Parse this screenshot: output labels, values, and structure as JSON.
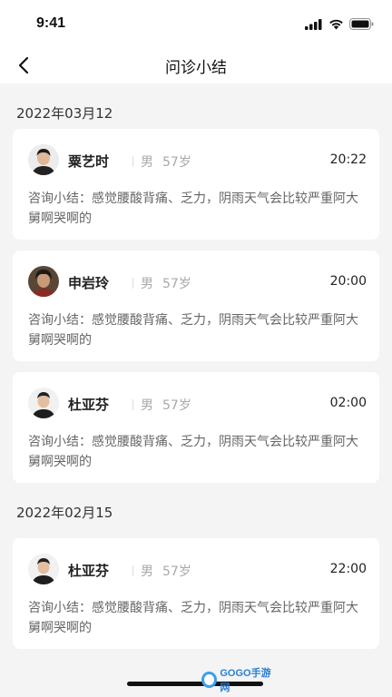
{
  "status_bar": {
    "time": "9:41"
  },
  "nav": {
    "title": "问诊小结"
  },
  "groups": [
    {
      "date": "2022年03月12",
      "records": [
        {
          "name": "粟艺时",
          "gender": "男",
          "age": "57岁",
          "time": "20:22",
          "summary": "咨询小结：感觉腰酸背痛、乏力，阴雨天气会比较严重阿大舅啊哭啊的"
        },
        {
          "name": "申岩玲",
          "gender": "男",
          "age": "57岁",
          "time": "20:00",
          "summary": "咨询小结：感觉腰酸背痛、乏力，阴雨天气会比较严重阿大舅啊哭啊的"
        },
        {
          "name": "杜亚芬",
          "gender": "男",
          "age": "57岁",
          "time": "02:00",
          "summary": "咨询小结：感觉腰酸背痛、乏力，阴雨天气会比较严重阿大舅啊哭啊的"
        }
      ]
    },
    {
      "date": "2022年02月15",
      "records": [
        {
          "name": "杜亚芬",
          "gender": "男",
          "age": "57岁",
          "time": "22:00",
          "summary": "咨询小结：感觉腰酸背痛、乏力，阴雨天气会比较严重阿大舅啊哭啊的"
        }
      ]
    }
  ],
  "watermark": {
    "text": "GOGO手游网"
  },
  "colors": {
    "background": "#f4f4f4",
    "card": "#ffffff",
    "muted": "#a8a8a8",
    "summary": "#666666"
  }
}
